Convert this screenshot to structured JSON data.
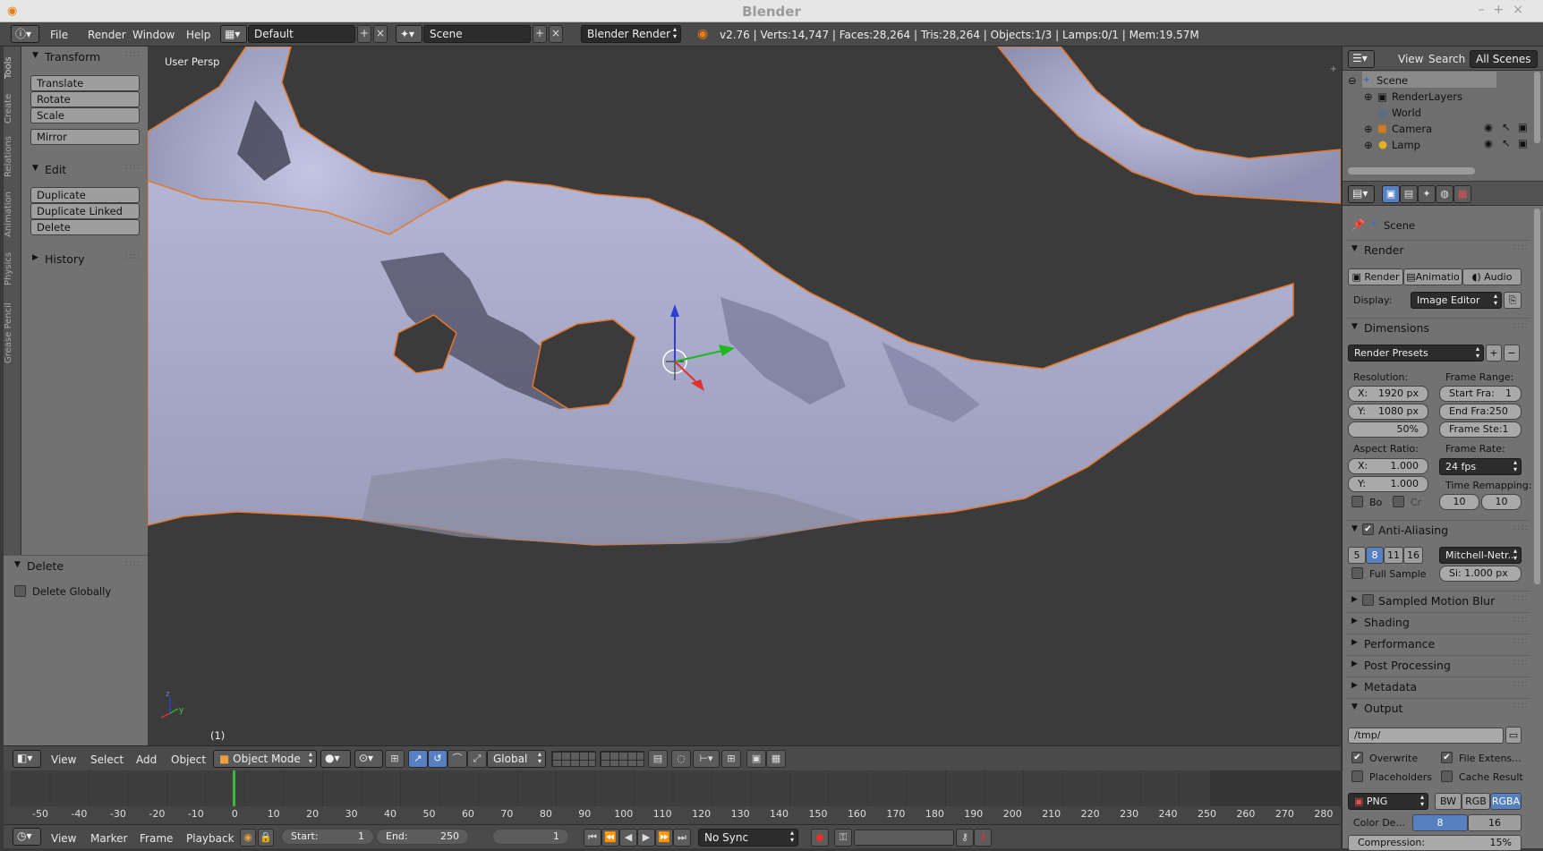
{
  "window": {
    "title": "Blender"
  },
  "topbar": {
    "menus": [
      "File",
      "Render",
      "Window",
      "Help"
    ],
    "screen_layout": "Default",
    "scene": "Scene",
    "render_engine": "Blender Render",
    "stats": "v2.76 | Verts:14,747 | Faces:28,264 | Tris:28,264 | Objects:1/3 | Lamps:0/1 | Mem:19.57M"
  },
  "tool_tabs": [
    "Tools",
    "Create",
    "Relations",
    "Animation",
    "Physics",
    "Grease Pencil"
  ],
  "tool_panel": {
    "transform": {
      "title": "Transform",
      "buttons": [
        "Translate",
        "Rotate",
        "Scale",
        "Mirror"
      ]
    },
    "edit": {
      "title": "Edit",
      "buttons": [
        "Duplicate",
        "Duplicate Linked",
        "Delete"
      ]
    },
    "history": {
      "title": "History"
    }
  },
  "last_operator": {
    "title": "Delete",
    "option": "Delete Globally",
    "option_checked": false
  },
  "viewport": {
    "label": "User Persp",
    "frame_label": "(1)"
  },
  "outliner": {
    "menus": [
      "View",
      "Search"
    ],
    "filter": "All Scenes",
    "items": [
      "Scene",
      "RenderLayers",
      "World",
      "Camera",
      "Lamp"
    ]
  },
  "properties": {
    "context": "Scene",
    "render": {
      "title": "Render",
      "buttons": [
        "Render",
        "Animatio",
        "Audio"
      ],
      "display_label": "Display:",
      "display_value": "Image Editor"
    },
    "dimensions": {
      "title": "Dimensions",
      "presets": "Render Presets",
      "resolution_label": "Resolution:",
      "res_x": "1920 px",
      "res_y": "1080 px",
      "res_pct": "50%",
      "frame_range_label": "Frame Range:",
      "start_frame": "Start Fra:",
      "start_frame_val": "1",
      "end_frame": "End Fra:250",
      "frame_step": "Frame Ste:1",
      "aspect_label": "Aspect Ratio:",
      "aspect_x": "1.000",
      "aspect_y": "1.000",
      "frame_rate_label": "Frame Rate:",
      "frame_rate": "24 fps",
      "time_remap_label": "Time Remapping:",
      "remap_old": "10",
      "remap_new": "10",
      "border_label": "Bo",
      "crop_label": "Cr"
    },
    "anti_aliasing": {
      "title": "Anti-Aliasing",
      "enabled": true,
      "samples": [
        "5",
        "8",
        "11",
        "16"
      ],
      "active_sample": "8",
      "filter": "Mitchell-Netr...",
      "full_sample": "Full Sample",
      "size": "Si: 1.000 px"
    },
    "collapsed": [
      "Sampled Motion Blur",
      "Shading",
      "Performance",
      "Post Processing",
      "Metadata"
    ],
    "output": {
      "title": "Output",
      "path": "/tmp/",
      "overwrite": "Overwrite",
      "file_extensions": "File Extens...",
      "placeholders": "Placeholders",
      "cache_result": "Cache Result",
      "format": "PNG",
      "color_modes": [
        "BW",
        "RGB",
        "RGBA"
      ],
      "active_color_mode": "RGBA",
      "color_depth_label": "Color De...",
      "depths": [
        "8",
        "16"
      ],
      "compression": "Compression:",
      "compression_val": "15%"
    }
  },
  "view3d_header": {
    "menus": [
      "View",
      "Select",
      "Add",
      "Object"
    ],
    "mode": "Object Mode",
    "orientation": "Global"
  },
  "timeline": {
    "ticks": [
      "-50",
      "-40",
      "-30",
      "-20",
      "-10",
      "0",
      "10",
      "20",
      "30",
      "40",
      "50",
      "60",
      "70",
      "80",
      "90",
      "100",
      "110",
      "120",
      "130",
      "140",
      "150",
      "160",
      "170",
      "180",
      "190",
      "200",
      "210",
      "220",
      "230",
      "240",
      "250",
      "260",
      "270",
      "280"
    ],
    "current_frame": 1
  },
  "timeline_header": {
    "menus": [
      "View",
      "Marker",
      "Frame",
      "Playback"
    ],
    "start_label": "Start:",
    "start_value": "1",
    "end_label": "End:",
    "end_value": "250",
    "current_frame": "1",
    "sync": "No Sync"
  },
  "colors": {
    "selection_outline": "#e8772a",
    "mesh": "#a8abcf",
    "accent": "#5680c2"
  }
}
